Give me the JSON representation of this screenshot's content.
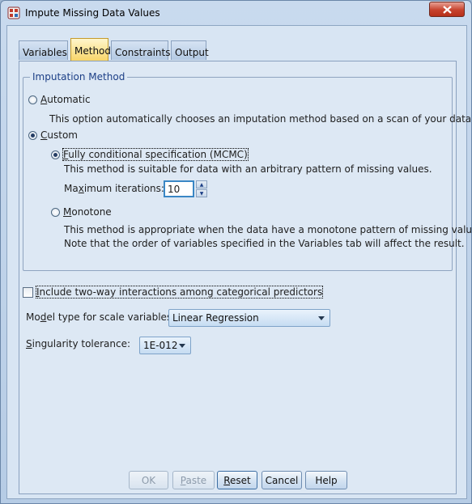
{
  "window": {
    "title": "Impute Missing Data Values"
  },
  "tabs": [
    {
      "label": "Variables"
    },
    {
      "label": "Method"
    },
    {
      "label": "Constraints"
    },
    {
      "label": "Output"
    }
  ],
  "imputation_method": {
    "legend": "Imputation Method",
    "automatic": {
      "label_mnemonic": "A",
      "label_rest": "utomatic",
      "description": "This option automatically chooses an imputation method based on a scan of your data."
    },
    "custom": {
      "label_mnemonic": "C",
      "label_rest": "ustom",
      "selected": true
    },
    "fcs": {
      "label_mnemonic": "F",
      "label_rest": "ully conditional specification (MCMC)",
      "description": "This method is suitable for data with an arbitrary pattern of missing values.",
      "max_iter_label_pre": "Ma",
      "max_iter_label_mnemonic": "x",
      "max_iter_label_post": "imum iterations:",
      "max_iter_value": "10"
    },
    "monotone": {
      "label_mnemonic": "M",
      "label_rest": "onotone",
      "description_line1": "This method is appropriate when the data have a monotone pattern of missing values.",
      "description_line2": "Note that the order of variables specified in the Variables tab will affect the result."
    }
  },
  "interactions": {
    "label_mnemonic": "I",
    "label_rest": "nclude two-way interactions among categorical predictors",
    "checked": false
  },
  "model_type": {
    "label_pre": "Mo",
    "label_mnemonic": "d",
    "label_post": "el type for scale variables:",
    "value": "Linear Regression"
  },
  "singularity": {
    "label_mnemonic": "S",
    "label_rest": "ingularity tolerance:",
    "value": "1E-012"
  },
  "buttons": {
    "ok": "OK",
    "paste_mnemonic": "P",
    "paste_rest": "aste",
    "reset_mnemonic": "R",
    "reset_rest": "eset",
    "cancel": "Cancel",
    "help": "Help"
  }
}
